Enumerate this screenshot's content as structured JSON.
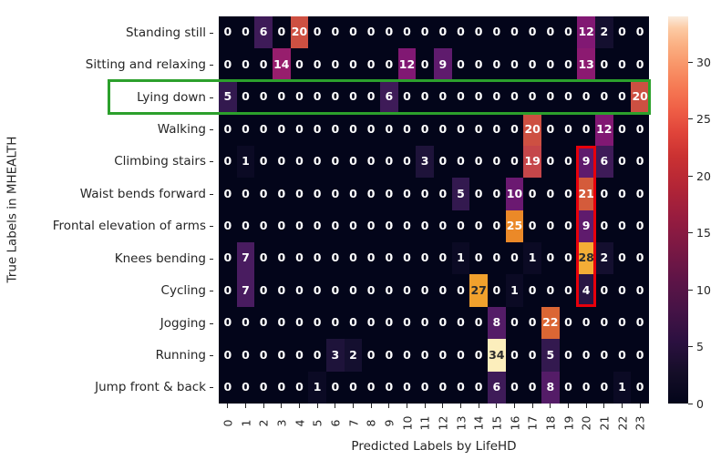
{
  "axes": {
    "ylabel_title": "True Labels in MHEALTH",
    "xlabel_title": "Predicted Labels by LifeHD"
  },
  "colorbar": {
    "ticks": [
      "0",
      "5",
      "10",
      "15",
      "20",
      "25",
      "30"
    ],
    "tick_values": [
      0,
      5,
      10,
      15,
      20,
      25,
      30
    ],
    "vmin": 0,
    "vmax": 34,
    "colormap": "rocket"
  },
  "highlights": [
    {
      "name": "green-row-highlight",
      "row": 2,
      "color": "#2ca02c",
      "kind": "row",
      "label": "Lying down"
    },
    {
      "name": "red-column-highlight",
      "col": 20,
      "row_start": 4,
      "row_end": 8,
      "color": "#e8000b",
      "kind": "column"
    }
  ],
  "chart_data": {
    "type": "heatmap",
    "title": "",
    "xlabel": "Predicted Labels by LifeHD",
    "ylabel": "True Labels in MHEALTH",
    "x_tick_labels": [
      "0",
      "1",
      "2",
      "3",
      "4",
      "5",
      "6",
      "7",
      "8",
      "9",
      "10",
      "11",
      "12",
      "13",
      "14",
      "15",
      "16",
      "17",
      "18",
      "19",
      "20",
      "21",
      "22",
      "23"
    ],
    "y_tick_labels": [
      "Standing still",
      "Sitting and relaxing",
      "Lying down",
      "Walking",
      "Climbing stairs",
      "Waist bends forward",
      "Frontal elevation of arms",
      "Knees bending",
      "Cycling",
      "Jogging",
      "Running",
      "Jump front & back"
    ],
    "annot": true,
    "grid": false,
    "vmin": 0,
    "vmax": 34,
    "values": [
      [
        0,
        0,
        6,
        0,
        20,
        0,
        0,
        0,
        0,
        0,
        0,
        0,
        0,
        0,
        0,
        0,
        0,
        0,
        0,
        0,
        12,
        2,
        0,
        0
      ],
      [
        0,
        0,
        0,
        14,
        0,
        0,
        0,
        0,
        0,
        0,
        12,
        0,
        9,
        0,
        0,
        0,
        0,
        0,
        0,
        0,
        13,
        0,
        0,
        0
      ],
      [
        5,
        0,
        0,
        0,
        0,
        0,
        0,
        0,
        0,
        6,
        0,
        0,
        0,
        0,
        0,
        0,
        0,
        0,
        0,
        0,
        0,
        0,
        0,
        20
      ],
      [
        0,
        0,
        0,
        0,
        0,
        0,
        0,
        0,
        0,
        0,
        0,
        0,
        0,
        0,
        0,
        0,
        0,
        20,
        0,
        0,
        0,
        12,
        0,
        0
      ],
      [
        0,
        1,
        0,
        0,
        0,
        0,
        0,
        0,
        0,
        0,
        0,
        3,
        0,
        0,
        0,
        0,
        0,
        19,
        0,
        0,
        9,
        6,
        0,
        0
      ],
      [
        0,
        0,
        0,
        0,
        0,
        0,
        0,
        0,
        0,
        0,
        0,
        0,
        0,
        5,
        0,
        0,
        10,
        0,
        0,
        0,
        21,
        0,
        0,
        0
      ],
      [
        0,
        0,
        0,
        0,
        0,
        0,
        0,
        0,
        0,
        0,
        0,
        0,
        0,
        0,
        0,
        0,
        25,
        0,
        0,
        0,
        9,
        0,
        0,
        0
      ],
      [
        0,
        7,
        0,
        0,
        0,
        0,
        0,
        0,
        0,
        0,
        0,
        0,
        0,
        1,
        0,
        0,
        0,
        1,
        0,
        0,
        28,
        2,
        0,
        0
      ],
      [
        0,
        7,
        0,
        0,
        0,
        0,
        0,
        0,
        0,
        0,
        0,
        0,
        0,
        0,
        27,
        0,
        1,
        0,
        0,
        0,
        4,
        0,
        0,
        0
      ],
      [
        0,
        0,
        0,
        0,
        0,
        0,
        0,
        0,
        0,
        0,
        0,
        0,
        0,
        0,
        0,
        8,
        0,
        0,
        22,
        0,
        0,
        0,
        0,
        0
      ],
      [
        0,
        0,
        0,
        0,
        0,
        0,
        3,
        2,
        0,
        0,
        0,
        0,
        0,
        0,
        0,
        34,
        0,
        0,
        5,
        0,
        0,
        0,
        0,
        0
      ],
      [
        0,
        0,
        0,
        0,
        0,
        1,
        0,
        0,
        0,
        0,
        0,
        0,
        0,
        0,
        0,
        6,
        0,
        0,
        8,
        0,
        0,
        0,
        1,
        0
      ]
    ]
  }
}
